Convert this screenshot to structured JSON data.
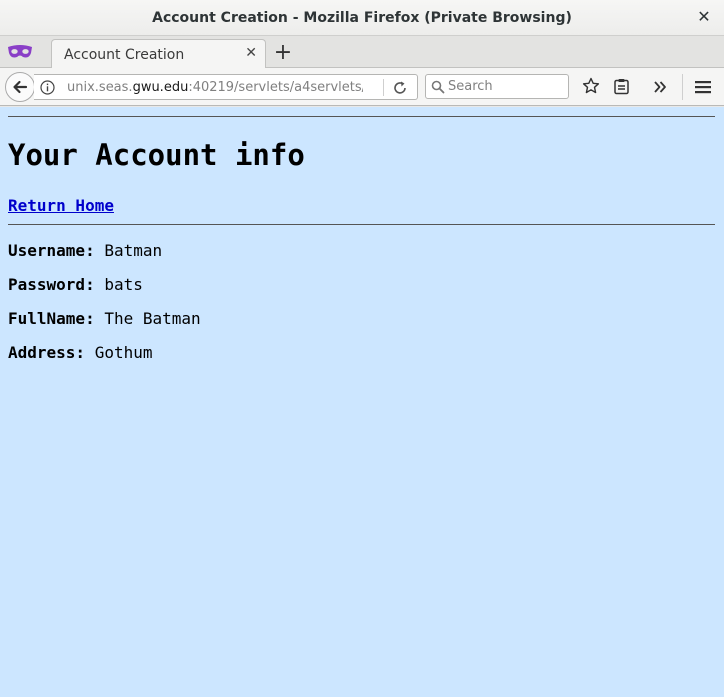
{
  "window": {
    "title": "Account Creation - Mozilla Firefox (Private Browsing)",
    "close_glyph": "✕"
  },
  "tabs": [
    {
      "label": "Account Creation",
      "active": true,
      "close_glyph": "✕"
    }
  ],
  "new_tab_glyph": "+",
  "url": {
    "prefix": "unix.seas.",
    "host": "gwu.edu",
    "rest": ":40219/servlets/a4servlets/"
  },
  "search": {
    "placeholder": "Search",
    "value": ""
  },
  "toolbar_icons": [
    "back-arrow-icon",
    "info-icon",
    "reload-icon",
    "search-icon",
    "bookmark-star-icon",
    "reader-view-icon",
    "overflow-chevron-icon",
    "hamburger-menu-icon"
  ],
  "private_icon": "private-mask-icon",
  "colors": {
    "page_bg": "#cce6ff",
    "link": "#0000cc",
    "private_mask": "#8a3fc7"
  },
  "page": {
    "heading": "Your Account info",
    "home_link": "Return Home",
    "fields": [
      {
        "label": "Username:",
        "value": "Batman"
      },
      {
        "label": "Password:",
        "value": "bats"
      },
      {
        "label": "FullName:",
        "value": "The Batman"
      },
      {
        "label": "Address:",
        "value": "Gothum"
      }
    ]
  }
}
